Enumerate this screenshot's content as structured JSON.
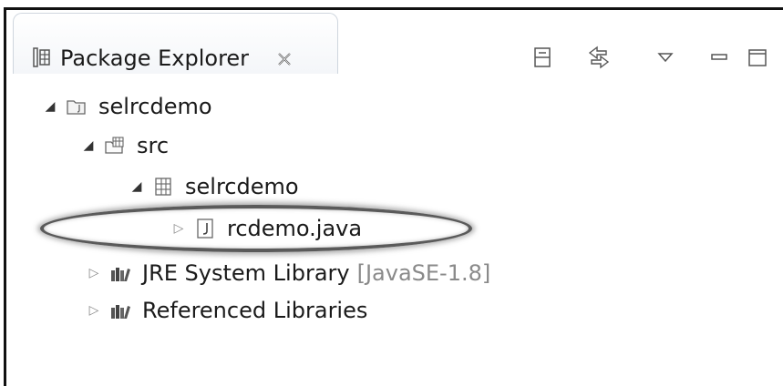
{
  "view": {
    "title": "Package Explorer",
    "icons": {
      "view": "package-explorer-icon",
      "close": "close-icon",
      "collapse_all": "collapse-all-icon",
      "link_with_editor": "link-with-editor-icon",
      "view_menu": "view-menu-icon",
      "minimize": "minimize-icon",
      "maximize": "maximize-icon"
    }
  },
  "tree": {
    "project": {
      "label": "selrcdemo",
      "icon": "java-project-icon"
    },
    "src_folder": {
      "label": "src",
      "icon": "source-folder-icon"
    },
    "package": {
      "label": "selrcdemo",
      "icon": "package-icon"
    },
    "java_file": {
      "label": "rcdemo.java",
      "icon": "java-file-icon",
      "highlighted": true
    },
    "jre_library": {
      "label": "JRE System Library",
      "decoration": "[JavaSE-1.8]",
      "icon": "library-icon"
    },
    "referenced_libraries": {
      "label": "Referenced Libraries",
      "icon": "library-icon"
    }
  }
}
